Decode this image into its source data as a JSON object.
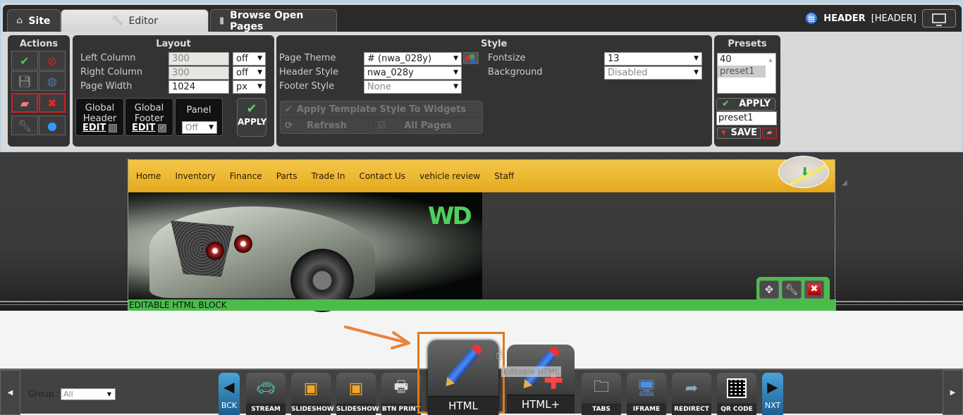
{
  "tabs": [
    {
      "label": "Site",
      "icon": "home-icon"
    },
    {
      "label": "Editor",
      "icon": "wrench-icon",
      "active": true
    },
    {
      "label": "Browse Open Pages",
      "icon": "notebook-icon"
    }
  ],
  "header_indicator": {
    "name": "HEADER",
    "bracket": "[HEADER]"
  },
  "actions": {
    "title": "Actions"
  },
  "layout": {
    "title": "Layout",
    "left_column": {
      "label": "Left Column",
      "value": "300",
      "unit": "off"
    },
    "right_column": {
      "label": "Right Column",
      "value": "300",
      "unit": "off"
    },
    "page_width": {
      "label": "Page Width",
      "value": "1024",
      "unit": "px"
    },
    "global_header": {
      "label_1": "Global",
      "label_2": "Header",
      "edit": "EDIT",
      "checked": false
    },
    "global_footer": {
      "label_1": "Global",
      "label_2": "Footer",
      "edit": "EDIT",
      "checked": true
    },
    "panel": {
      "label": "Panel",
      "value": "Off"
    },
    "apply_label": "APPLY"
  },
  "style": {
    "title": "Style",
    "page_theme": {
      "label": "Page Theme",
      "value": "# (nwa_028y)"
    },
    "header_style": {
      "label": "Header Style",
      "value": "nwa_028y"
    },
    "footer_style": {
      "label": "Footer Style",
      "value": "None"
    },
    "fontsize": {
      "label": "Fontsize",
      "value": "13"
    },
    "background": {
      "label": "Background",
      "value": "Disabled"
    },
    "apply_template": "Apply Template Style To Widgets",
    "refresh": "Refresh",
    "all_pages": "All Pages"
  },
  "presets": {
    "title": "Presets",
    "items": [
      "40",
      "preset1"
    ],
    "selected": "preset1",
    "apply_label": "APPLY",
    "name_value": "preset1",
    "save_label": "SAVE"
  },
  "site_preview": {
    "nav": [
      "Home",
      "Inventory",
      "Finance",
      "Parts",
      "Trade In",
      "Contact Us",
      "vehicle review",
      "Staff"
    ],
    "logo_text": "WD",
    "block_label": "EDITABLE HTML BLOCK"
  },
  "bottom_toolbar": {
    "group_label": "Group :",
    "group_value": "All",
    "back_label": "BCK",
    "next_label": "NXT",
    "widgets": [
      {
        "label": "STREAM",
        "icon": "webcam-car-icon"
      },
      {
        "label": "SLIDESHOW",
        "icon": "slideshow-icon"
      },
      {
        "label": "SLIDESHOW",
        "icon": "slideshow-icon"
      },
      {
        "label": "BTN PRINT",
        "icon": "printer-icon"
      },
      {
        "label": "HTML",
        "icon": "pencil-icon",
        "highlighted": true
      },
      {
        "label": "HTML+",
        "icon": "pencil-plus-icon"
      },
      {
        "label": "TABS",
        "icon": "folders-icon"
      },
      {
        "label": "IFRAME",
        "icon": "iframe-monitor-icon"
      },
      {
        "label": "REDIRECT",
        "icon": "globe-arrow-icon"
      },
      {
        "label": "QR CODE",
        "icon": "qr-code-icon"
      }
    ],
    "tooltip": "Editable HTML"
  },
  "colors": {
    "highlight_orange": "#e07a1c",
    "block_green": "#4cbb4c",
    "nav_yellow": "#edb832",
    "nav_blue": "#2b82bd"
  }
}
